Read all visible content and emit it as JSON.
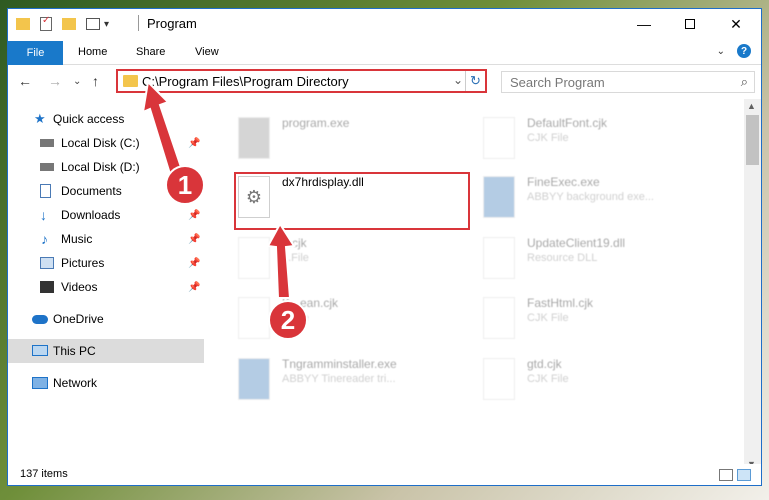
{
  "window": {
    "title": "Program"
  },
  "ribbon": {
    "file": "File",
    "home": "Home",
    "share": "Share",
    "view": "View",
    "help": "?"
  },
  "nav": {
    "back": "←",
    "forward": "→",
    "recent": "⌄",
    "up": "↑"
  },
  "address": {
    "path": "C:\\Program Files\\Program Directory",
    "dropdown": "⌄",
    "refresh": "↻"
  },
  "search": {
    "placeholder": "Search Program",
    "icon": "⌕"
  },
  "sidebar": {
    "items": [
      {
        "label": "Quick access",
        "icon": "star-icon",
        "color": "#1e73c8"
      },
      {
        "label": "Local Disk (C:)",
        "icon": "drive-icon",
        "color": "#555555"
      },
      {
        "label": "Local Disk (D:)",
        "icon": "drive-icon",
        "color": "#555555"
      },
      {
        "label": "Documents",
        "icon": "documents-icon",
        "color": "#4a7ab5"
      },
      {
        "label": "Downloads",
        "icon": "downloads-icon",
        "color": "#1e73c8"
      },
      {
        "label": "Music",
        "icon": "music-icon",
        "color": "#1e73c8"
      },
      {
        "label": "Pictures",
        "icon": "pictures-icon",
        "color": "#4a7ab5"
      },
      {
        "label": "Videos",
        "icon": "videos-icon",
        "color": "#333333"
      },
      {
        "label": "OneDrive",
        "icon": "cloud-icon",
        "color": "#1e73c8"
      },
      {
        "label": "This PC",
        "icon": "computer-icon",
        "color": "#1e73c8"
      },
      {
        "label": "Network",
        "icon": "network-icon",
        "color": "#1e73c8"
      }
    ]
  },
  "files": [
    {
      "name": "program.exe",
      "type": "",
      "faded": true
    },
    {
      "name": "DefaultFont.cjk",
      "type": "CJK File",
      "faded": true
    },
    {
      "name": "dx7hrdisplay.dll",
      "type": "",
      "faded": false
    },
    {
      "name": "FineExec.exe",
      "type": "ABBYY background exe...",
      "faded": true
    },
    {
      "name": "...cjk",
      "type": "...File",
      "faded": true
    },
    {
      "name": "UpdateClient19.dll",
      "type": "Resource DLL",
      "faded": true
    },
    {
      "name": "K...ean.cjk",
      "type": "...File",
      "faded": true
    },
    {
      "name": "FastHtml.cjk",
      "type": "CJK File",
      "faded": true
    },
    {
      "name": "Tngramminstaller.exe",
      "type": "ABBYY Tinereader tri...",
      "faded": true
    },
    {
      "name": "gtd.cjk",
      "type": "CJK File",
      "faded": true
    }
  ],
  "status": {
    "count": "137 items"
  },
  "annotations": {
    "step1": "1",
    "step2": "2",
    "color": "#d9353a"
  }
}
